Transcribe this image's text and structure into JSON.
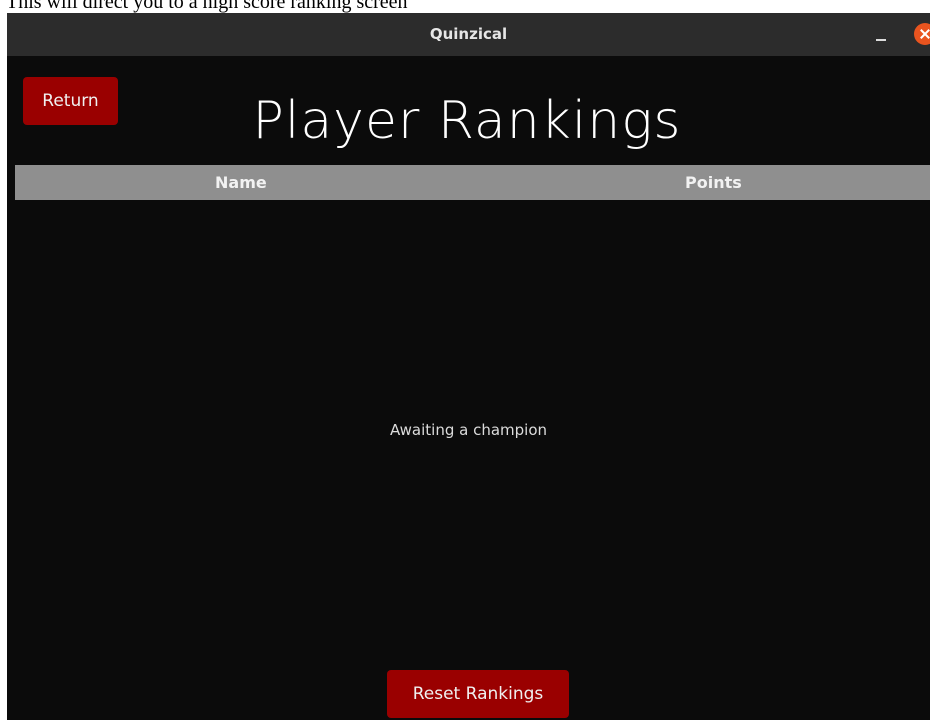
{
  "caption": "This will direct you to a high score ranking screen",
  "window": {
    "title": "Quinzical"
  },
  "header": {
    "return_label": "Return",
    "page_title": "Player Rankings"
  },
  "table": {
    "columns": [
      "Name",
      "Points"
    ],
    "rows": [],
    "empty_message": "Awaiting a champion"
  },
  "footer": {
    "reset_label": "Reset Rankings"
  },
  "colors": {
    "accent": "#9a0000",
    "background": "#0b0b0b",
    "header_bg": "#8f8f8f",
    "titlebar": "#2c2c2c",
    "close": "#e9541f"
  }
}
